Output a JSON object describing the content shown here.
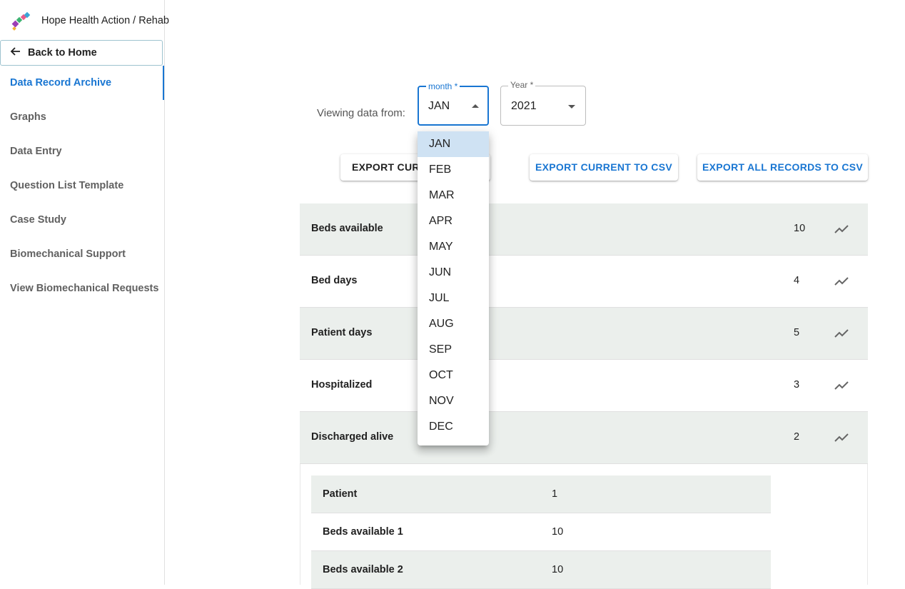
{
  "app": {
    "title": "Hope Health Action / Rehab"
  },
  "sidebar": {
    "back_label": "Back to Home",
    "items": [
      {
        "label": "Data Record Archive",
        "active": true
      },
      {
        "label": "Graphs"
      },
      {
        "label": "Data Entry"
      },
      {
        "label": "Question List Template"
      },
      {
        "label": "Case Study"
      },
      {
        "label": "Biomechanical Support"
      },
      {
        "label": "View Biomechanical Requests"
      }
    ]
  },
  "filter": {
    "viewing_label": "Viewing data from:",
    "month_label": "month *",
    "month_value": "JAN",
    "year_label": "Year *",
    "year_value": "2021"
  },
  "toolbar": {
    "print_label": "EXPORT CURRENT TO PDF",
    "export_csv_label": "EXPORT CURRENT TO CSV",
    "export_all_label": "EXPORT ALL RECORDS TO CSV"
  },
  "records": [
    {
      "label": "Beds available",
      "value": "10"
    },
    {
      "label": "Bed days",
      "value": "4"
    },
    {
      "label": "Patient days",
      "value": "5"
    },
    {
      "label": "Hospitalized",
      "value": "3"
    },
    {
      "label": "Discharged alive",
      "value": "2"
    }
  ],
  "subrecords": [
    {
      "label": "Patient",
      "value": "1"
    },
    {
      "label": "Beds available 1",
      "value": "10"
    },
    {
      "label": "Beds available 2",
      "value": "10"
    }
  ],
  "month_menu": {
    "options": [
      "JAN",
      "FEB",
      "MAR",
      "APR",
      "MAY",
      "JUN",
      "JUL",
      "AUG",
      "SEP",
      "OCT",
      "NOV",
      "DEC"
    ],
    "selected": "JAN"
  },
  "colors": {
    "accent": "#1976d2",
    "row_shade": "#ebefec",
    "selected_option": "#cfe2f3"
  },
  "icons": {
    "back": "arrow-left-icon",
    "trend": "trending-up-icon",
    "logo": "app-logo-icon"
  }
}
